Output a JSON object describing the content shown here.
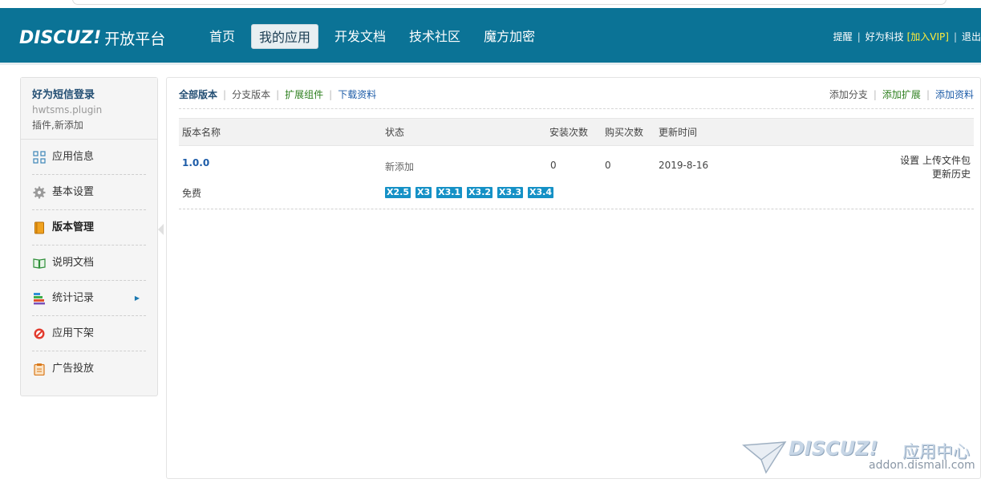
{
  "header": {
    "logo_text": "DISCUZ!",
    "logo_sub": "开放平台",
    "nav": [
      {
        "label": "首页",
        "active": false
      },
      {
        "label": "我的应用",
        "active": true
      },
      {
        "label": "开发文档",
        "active": false
      },
      {
        "label": "技术社区",
        "active": false
      },
      {
        "label": "魔方加密",
        "active": false
      }
    ],
    "user": {
      "remind": "提醒",
      "name": "好为科技",
      "vip": "[加入VIP]",
      "logout": "退出"
    }
  },
  "sidebar": {
    "app_title": "好为短信登录",
    "app_id": "hwtsms.plugin",
    "app_status": "插件,新添加",
    "items": [
      {
        "label": "应用信息",
        "icon": "grid-icon"
      },
      {
        "label": "基本设置",
        "icon": "gear-icon"
      },
      {
        "label": "版本管理",
        "icon": "book-icon",
        "active": true
      },
      {
        "label": "说明文档",
        "icon": "open-book-icon"
      },
      {
        "label": "统计记录",
        "icon": "stack-icon"
      },
      {
        "label": "应用下架",
        "icon": "no-entry-icon"
      },
      {
        "label": "广告投放",
        "icon": "clipboard-icon"
      }
    ]
  },
  "main": {
    "tabs": [
      "全部版本",
      "分支版本",
      "扩展组件",
      "下载资料"
    ],
    "right_tabs": [
      "添加分支",
      "添加扩展",
      "添加资料"
    ],
    "columns": [
      "版本名称",
      "状态",
      "安装次数",
      "购买次数",
      "更新时间"
    ],
    "rows": [
      {
        "version": "1.0.0",
        "price": "免费",
        "status": "新添加",
        "installs": "0",
        "purchases": "0",
        "updated": "2019-8-16",
        "compat": [
          "X2.5",
          "X3",
          "X3.1",
          "X3.2",
          "X3.3",
          "X3.4"
        ],
        "actions": {
          "settings": "设置",
          "upload": "上传文件包",
          "history": "更新历史"
        }
      }
    ]
  },
  "watermark": {
    "logo": "DISCUZ!",
    "sub": "应用中心",
    "url": "addon.dismall.com"
  },
  "colors": {
    "header_bg": "#0b7396",
    "badge_bg": "#1591c6",
    "link_blue": "#1d5ca8",
    "link_green": "#2d7f1e"
  }
}
